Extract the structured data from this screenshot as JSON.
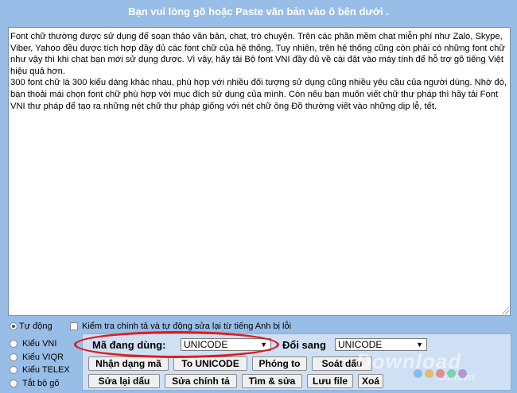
{
  "header": {
    "title": "Bạn vui lòng gõ hoặc Paste văn bản vào ô bên dưới ."
  },
  "editor": {
    "text": "Font chữ thường được sử dụng để soạn thảo văn bản, chat, trò chuyện. Trên các phần mềm chat miễn phí như Zalo, Skype, Viber, Yahoo đều được tích hợp đầy đủ các font chữ của hệ thống. Tuy nhiên, trên hệ thống cũng còn phải có những font chữ như vậy thì khi chat bạn mới sử dụng được. Vì vậy, hãy tải Bộ font VNI đầy đủ về cài đặt vào máy tính để hỗ trợ gõ tiếng Việt hiệu quả hơn.\n300 font chữ là 300 kiểu dáng khác nhau, phù hợp với nhiều đối tượng sử dụng cũng nhiều yêu cầu của người dùng. Nhờ đó, bạn thoải mái chọn font chữ phù hợp với mục đích sử dụng của mình. Còn nếu bạn muốn viết chữ thư pháp thì hãy tải Font VNI thư pháp để tạo ra những nét chữ thư pháp giống với nét chữ ông Đồ thường viết vào những dịp lễ, tết."
  },
  "input_modes": [
    {
      "label": "Tự động",
      "selected": true
    },
    {
      "label": "Kiểu VNI",
      "selected": false
    },
    {
      "label": "Kiểu VIQR",
      "selected": false
    },
    {
      "label": "Kiểu TELEX",
      "selected": false
    },
    {
      "label": "Tắt bộ gõ",
      "selected": false
    }
  ],
  "spellcheck": {
    "label": "Kiểm tra chính tả và tự động sửa lại từ tiếng Anh bị lỗi",
    "checked": false
  },
  "encoding": {
    "current_label": "Mã đang dùng:",
    "current_value": "UNICODE",
    "convert_label": "Đổi sang",
    "convert_value": "UNICODE"
  },
  "buttons": {
    "detect": "Nhận dạng mã",
    "to_unicode": "To UNICODE",
    "convert": "Phóng to",
    "check_accent": "Soát dấu",
    "fix_accent": "Sửa lại dấu",
    "fix_spelling": "Sửa chính tả",
    "find_replace": "Tìm & sửa",
    "save_file": "Lưu file",
    "delete": "Xoá"
  },
  "watermark": {
    "brand": "Download",
    "domain": ".com.vn"
  },
  "colors": {
    "background": "#98bde6",
    "highlight": "#e01b1b"
  }
}
